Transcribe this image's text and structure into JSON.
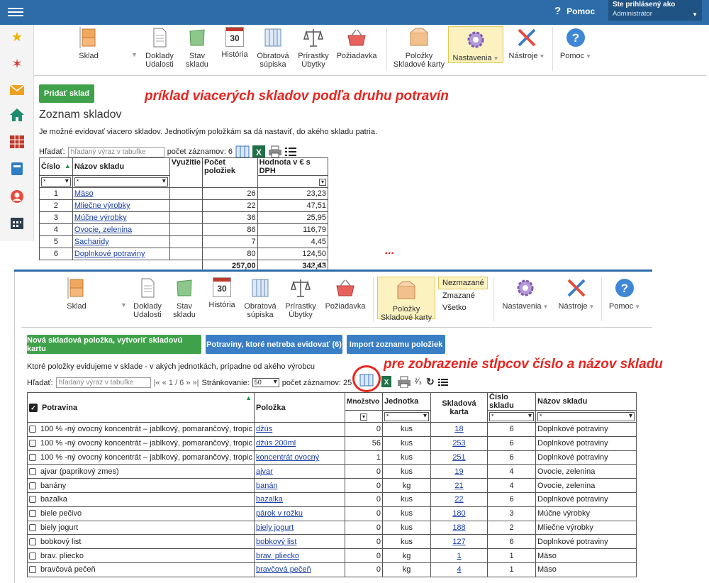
{
  "topbar": {
    "help": "Pomoc",
    "user_line1": "Ste prihlásený ako",
    "user_line2": "Administrátor"
  },
  "toolbar1": {
    "items": [
      {
        "label": "Sklad"
      },
      {
        "label": "Doklady Udalosti"
      },
      {
        "label": "Stav skladu"
      },
      {
        "label": "História",
        "num": "30"
      },
      {
        "label": "Obratová súpiska"
      },
      {
        "label": "Prírastky Úbytky"
      },
      {
        "label": "Požiadavka"
      },
      {
        "label": "Položky Skladové karty"
      },
      {
        "label": "Nastavenia"
      },
      {
        "label": "Nástroje"
      },
      {
        "label": "Pomoc"
      }
    ]
  },
  "toolbar2": {
    "items": [
      {
        "label": "Sklad"
      },
      {
        "label": "Doklady Udalosti"
      },
      {
        "label": "Stav skladu"
      },
      {
        "label": "História",
        "num": "30"
      },
      {
        "label": "Obratová súpiska"
      },
      {
        "label": "Prírastky Úbytky"
      },
      {
        "label": "Požiadavka"
      },
      {
        "label": "Položky Skladové karty"
      },
      {
        "label": "Nastavenia"
      },
      {
        "label": "Nástroje"
      },
      {
        "label": "Pomoc"
      }
    ],
    "filters": [
      "Nezmazané",
      "Zmazané",
      "Všetko"
    ]
  },
  "panel1": {
    "add_button": "Pridať sklad",
    "annotation": "príklad viacerých skladov podľa druhu potravín",
    "title": "Zoznam skladov",
    "description": "Je možné evidovať viacero skladov. Jednotlivým položkám sa dá nastaviť, do akého skladu patria.",
    "search_label": "Hľadať:",
    "search_placeholder": "hľadaný výraz v tabuľke",
    "count_label": "počet záznamov: 6",
    "headers": [
      "Číslo",
      "Názov skladu",
      "Využitie",
      "Počet položiek",
      "Hodnota v € s DPH"
    ],
    "filter_value": "*",
    "rows": [
      [
        "1",
        "Mäso",
        "",
        "26",
        "23,23"
      ],
      [
        "2",
        "Mliečne výrobky",
        "",
        "22",
        "47,51"
      ],
      [
        "3",
        "Múčne výrobky",
        "",
        "36",
        "25,95"
      ],
      [
        "4",
        "Ovocie, zelenina",
        "",
        "86",
        "116,79"
      ],
      [
        "5",
        "Sacharidy",
        "",
        "7",
        "4,45"
      ],
      [
        "6",
        "Doplnkové potraviny",
        "",
        "80",
        "124,50"
      ]
    ],
    "totals": [
      "257,00",
      "342,43"
    ],
    "ellipsis": "..."
  },
  "panel2": {
    "btn_new": "Nová skladová položka, vytvoriť skladovú kartu",
    "btn_food": "Potraviny, ktoré netreba evidovať (6)",
    "btn_import": "Import zoznamu položiek",
    "annotation": "pre zobrazenie stĺpcov  číslo a názov skladu",
    "description": "Ktoré položky evidujeme v sklade - v akých jednotkách, prípadne od akého výrobcu",
    "search_label": "Hľadať:",
    "search_placeholder": "hľadaný výraz v tabuľke",
    "pager": "|« « 1 / 6 » »|",
    "paging_label": "Stránkovanie:",
    "paging_value": "50",
    "count_label": "počet záznamov: 25",
    "page_frac": "²⁄₃",
    "headers": [
      "Potravina",
      "Položka",
      "Množstvo",
      "Jednotka",
      "Skladová karta",
      "Číslo skladu",
      "Názov skladu"
    ],
    "filter_value": "*",
    "rows": [
      [
        "100 % -ný ovocný koncentrát – jablkový, pomarančový, tropic",
        "džús",
        "0",
        "kus",
        "18",
        "6",
        "Doplnkové potraviny"
      ],
      [
        "100 % -ný ovocný koncentrát – jablkový, pomarančový, tropic",
        "džús 200ml",
        "56",
        "kus",
        "253",
        "6",
        "Doplnkové potraviny"
      ],
      [
        "100 % -ný ovocný koncentrát – jablkový, pomarančový, tropic",
        "koncentrát ovocný",
        "1",
        "kus",
        "251",
        "6",
        "Doplnkové potraviny"
      ],
      [
        "ajvar (paprikový zmes)",
        "ajvar",
        "0",
        "kus",
        "19",
        "4",
        "Ovocie, zelenina"
      ],
      [
        "banány",
        "banán",
        "0",
        "kg",
        "21",
        "4",
        "Ovocie, zelenina"
      ],
      [
        "bazalka",
        "bazalka",
        "0",
        "kus",
        "22",
        "6",
        "Doplnkové potraviny"
      ],
      [
        "biele pečivo",
        "párok v rožku",
        "0",
        "kus",
        "180",
        "3",
        "Múčne výrobky"
      ],
      [
        "biely jogurt",
        "biely jogurt",
        "0",
        "kus",
        "188",
        "2",
        "Mliečne výrobky"
      ],
      [
        "bobkový list",
        "bobkový list",
        "0",
        "kus",
        "127",
        "6",
        "Doplnkové potraviny"
      ],
      [
        "brav. pliecko",
        "brav. pliecko",
        "0",
        "kg",
        "1",
        "1",
        "Mäso"
      ],
      [
        "bravčová pečeň",
        "bravčová pečeň",
        "0",
        "kg",
        "4",
        "1",
        "Mäso"
      ]
    ]
  }
}
